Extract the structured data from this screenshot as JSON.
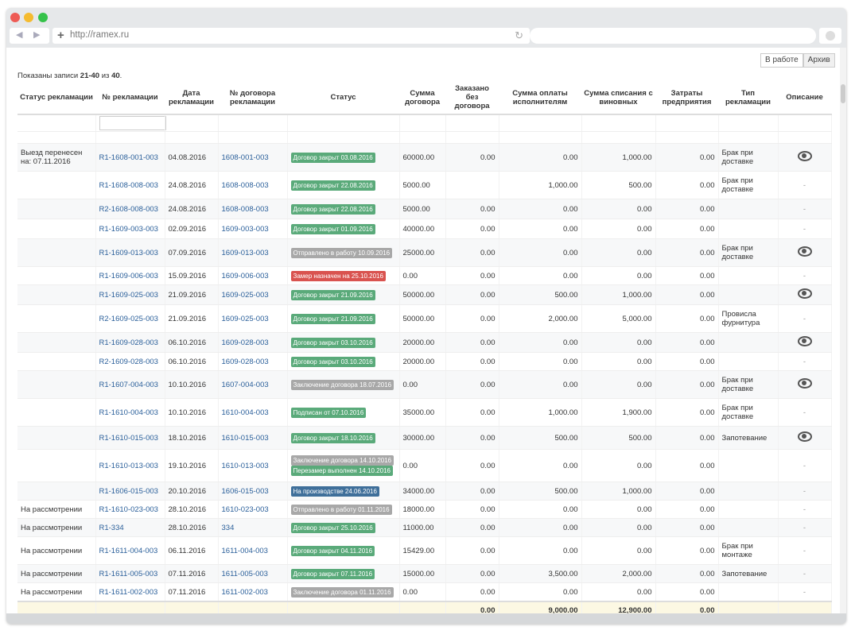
{
  "browser": {
    "url": "http://ramex.ru"
  },
  "tabs": [
    "В работе",
    "Архив"
  ],
  "records": {
    "prefix": "Показаны записи ",
    "range": "21-40",
    "of": " из ",
    "total": "40",
    "suffix": "."
  },
  "columns": [
    "Статус рекламации",
    "№ рекламации",
    "Дата рекламации",
    "№ договора рекламации",
    "Статус",
    "Сумма договора",
    "Заказано без договора",
    "Сумма оплаты исполнителям",
    "Сумма списания с виновных",
    "Затраты предприятия",
    "Тип рекламации",
    "Описание"
  ],
  "rows": [
    {
      "status": "Выезд перенесен на: 07.11.2016",
      "num": "R1-1608-001-003",
      "date": "04.08.2016",
      "contract": "1608-001-003",
      "badges": [
        {
          "text": "Договор закрыт 03.08.2016",
          "color": "green"
        }
      ],
      "sum": "60000.00",
      "ordered": "0.00",
      "paid": "0.00",
      "writeoff": "1,000.00",
      "costs": "0.00",
      "type": "Брак при доставке",
      "desc": "eye"
    },
    {
      "status": "",
      "num": "R1-1608-008-003",
      "date": "24.08.2016",
      "contract": "1608-008-003",
      "badges": [
        {
          "text": "Договор закрыт 22.08.2016",
          "color": "green"
        }
      ],
      "sum": "5000.00",
      "ordered": "",
      "paid": "1,000.00",
      "writeoff": "500.00",
      "costs": "0.00",
      "type": "Брак при доставке",
      "desc": "-"
    },
    {
      "status": "",
      "num": "R2-1608-008-003",
      "date": "24.08.2016",
      "contract": "1608-008-003",
      "badges": [
        {
          "text": "Договор закрыт 22.08.2016",
          "color": "green"
        }
      ],
      "sum": "5000.00",
      "ordered": "0.00",
      "paid": "0.00",
      "writeoff": "0.00",
      "costs": "0.00",
      "type": "",
      "desc": "-"
    },
    {
      "status": "",
      "num": "R1-1609-003-003",
      "date": "02.09.2016",
      "contract": "1609-003-003",
      "badges": [
        {
          "text": "Договор закрыт 01.09.2016",
          "color": "green"
        }
      ],
      "sum": "40000.00",
      "ordered": "0.00",
      "paid": "0.00",
      "writeoff": "0.00",
      "costs": "0.00",
      "type": "",
      "desc": "-"
    },
    {
      "status": "",
      "num": "R1-1609-013-003",
      "date": "07.09.2016",
      "contract": "1609-013-003",
      "badges": [
        {
          "text": "Отправлено в работу 10.09.2016",
          "color": "gray"
        }
      ],
      "sum": "25000.00",
      "ordered": "0.00",
      "paid": "0.00",
      "writeoff": "0.00",
      "costs": "0.00",
      "type": "Брак при доставке",
      "desc": "eye"
    },
    {
      "status": "",
      "num": "R1-1609-006-003",
      "date": "15.09.2016",
      "contract": "1609-006-003",
      "badges": [
        {
          "text": "Замер назначен на 25.10.2016",
          "color": "red"
        }
      ],
      "sum": "0.00",
      "ordered": "0.00",
      "paid": "0.00",
      "writeoff": "0.00",
      "costs": "0.00",
      "type": "",
      "desc": "-"
    },
    {
      "status": "",
      "num": "R1-1609-025-003",
      "date": "21.09.2016",
      "contract": "1609-025-003",
      "badges": [
        {
          "text": "Договор закрыт 21.09.2016",
          "color": "green"
        }
      ],
      "sum": "50000.00",
      "ordered": "0.00",
      "paid": "500.00",
      "writeoff": "1,000.00",
      "costs": "0.00",
      "type": "",
      "desc": "eye"
    },
    {
      "status": "",
      "num": "R2-1609-025-003",
      "date": "21.09.2016",
      "contract": "1609-025-003",
      "badges": [
        {
          "text": "Договор закрыт 21.09.2016",
          "color": "green"
        }
      ],
      "sum": "50000.00",
      "ordered": "0.00",
      "paid": "2,000.00",
      "writeoff": "5,000.00",
      "costs": "0.00",
      "type": "Провисла фурнитура",
      "desc": "-"
    },
    {
      "status": "",
      "num": "R1-1609-028-003",
      "date": "06.10.2016",
      "contract": "1609-028-003",
      "badges": [
        {
          "text": "Договор закрыт 03.10.2016",
          "color": "green"
        }
      ],
      "sum": "20000.00",
      "ordered": "0.00",
      "paid": "0.00",
      "writeoff": "0.00",
      "costs": "0.00",
      "type": "",
      "desc": "eye"
    },
    {
      "status": "",
      "num": "R2-1609-028-003",
      "date": "06.10.2016",
      "contract": "1609-028-003",
      "badges": [
        {
          "text": "Договор закрыт 03.10.2016",
          "color": "green"
        }
      ],
      "sum": "20000.00",
      "ordered": "0.00",
      "paid": "0.00",
      "writeoff": "0.00",
      "costs": "0.00",
      "type": "",
      "desc": "-"
    },
    {
      "status": "",
      "num": "R1-1607-004-003",
      "date": "10.10.2016",
      "contract": "1607-004-003",
      "badges": [
        {
          "text": "Заключение договора 18.07.2016",
          "color": "gray"
        }
      ],
      "sum": "0.00",
      "ordered": "0.00",
      "paid": "0.00",
      "writeoff": "0.00",
      "costs": "0.00",
      "type": "Брак при доставке",
      "desc": "eye"
    },
    {
      "status": "",
      "num": "R1-1610-004-003",
      "date": "10.10.2016",
      "contract": "1610-004-003",
      "badges": [
        {
          "text": "Подписан от 07.10.2016",
          "color": "green"
        }
      ],
      "sum": "35000.00",
      "ordered": "0.00",
      "paid": "1,000.00",
      "writeoff": "1,900.00",
      "costs": "0.00",
      "type": "Брак при доставке",
      "desc": "-"
    },
    {
      "status": "",
      "num": "R1-1610-015-003",
      "date": "18.10.2016",
      "contract": "1610-015-003",
      "badges": [
        {
          "text": "Договор закрыт 18.10.2016",
          "color": "green"
        }
      ],
      "sum": "30000.00",
      "ordered": "0.00",
      "paid": "500.00",
      "writeoff": "500.00",
      "costs": "0.00",
      "type": "Запотевание",
      "desc": "eye"
    },
    {
      "status": "",
      "num": "R1-1610-013-003",
      "date": "19.10.2016",
      "contract": "1610-013-003",
      "badges": [
        {
          "text": "Заключение договора 14.10.2016",
          "color": "gray"
        },
        {
          "text": "Перезамер выполнен 14.10.2016",
          "color": "green"
        }
      ],
      "sum": "0.00",
      "ordered": "0.00",
      "paid": "0.00",
      "writeoff": "0.00",
      "costs": "0.00",
      "type": "",
      "desc": "-"
    },
    {
      "status": "",
      "num": "R1-1606-015-003",
      "date": "20.10.2016",
      "contract": "1606-015-003",
      "badges": [
        {
          "text": "На производстве 24.06.2016",
          "color": "blue"
        }
      ],
      "sum": "34000.00",
      "ordered": "0.00",
      "paid": "500.00",
      "writeoff": "1,000.00",
      "costs": "0.00",
      "type": "",
      "desc": "-"
    },
    {
      "status": "На рассмотрении",
      "num": "R1-1610-023-003",
      "date": "28.10.2016",
      "contract": "1610-023-003",
      "badges": [
        {
          "text": "Отправлено в работу 01.11.2016",
          "color": "gray"
        }
      ],
      "sum": "18000.00",
      "ordered": "0.00",
      "paid": "0.00",
      "writeoff": "0.00",
      "costs": "0.00",
      "type": "",
      "desc": "-"
    },
    {
      "status": "На рассмотрении",
      "num": "R1-334",
      "date": "28.10.2016",
      "contract": "334",
      "badges": [
        {
          "text": "Договор закрыт 25.10.2016",
          "color": "green"
        }
      ],
      "sum": "11000.00",
      "ordered": "0.00",
      "paid": "0.00",
      "writeoff": "0.00",
      "costs": "0.00",
      "type": "",
      "desc": "-"
    },
    {
      "status": "На рассмотрении",
      "num": "R1-1611-004-003",
      "date": "06.11.2016",
      "contract": "1611-004-003",
      "badges": [
        {
          "text": "Договор закрыт 04.11.2016",
          "color": "green"
        }
      ],
      "sum": "15429.00",
      "ordered": "0.00",
      "paid": "0.00",
      "writeoff": "0.00",
      "costs": "0.00",
      "type": "Брак при монтаже",
      "desc": "-"
    },
    {
      "status": "На рассмотрении",
      "num": "R1-1611-005-003",
      "date": "07.11.2016",
      "contract": "1611-005-003",
      "badges": [
        {
          "text": "Договор закрыт 07.11.2016",
          "color": "green"
        }
      ],
      "sum": "15000.00",
      "ordered": "0.00",
      "paid": "3,500.00",
      "writeoff": "2,000.00",
      "costs": "0.00",
      "type": "Запотевание",
      "desc": "-"
    },
    {
      "status": "На рассмотрении",
      "num": "R1-1611-002-003",
      "date": "07.11.2016",
      "contract": "1611-002-003",
      "badges": [
        {
          "text": "Заключение договора 01.11.2016",
          "color": "gray"
        }
      ],
      "sum": "0.00",
      "ordered": "0.00",
      "paid": "0.00",
      "writeoff": "0.00",
      "costs": "0.00",
      "type": "",
      "desc": "-"
    }
  ],
  "totals": {
    "ordered": "0.00",
    "paid": "9,000.00",
    "writeoff": "12,900.00",
    "costs": "0.00"
  },
  "colors": {
    "link": "#2a5f9a",
    "green": "#5aaa7a",
    "gray": "#a8a8a8",
    "red": "#d9534f",
    "blue": "#3f6f9a",
    "total_bg": "#fcf8e3"
  }
}
